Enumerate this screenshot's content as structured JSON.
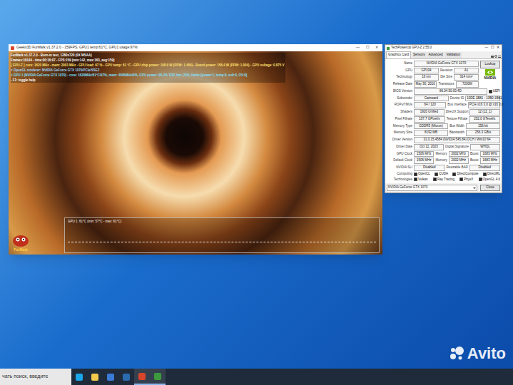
{
  "furmark": {
    "title": "Geeks3D FurMark v1.37.2.0 - 159FPS, GPU1 temp:61°C, GPU1 usage:97%",
    "controls": [
      "—",
      "☐",
      "✕"
    ],
    "overlay": [
      {
        "text": "FurMark v1.37.2.0 - Burn-in test, 1280x720 (0X MSAA)",
        "color": "#ffffff"
      },
      {
        "text": "Frames:16144 - time:00:16:07 - FPS:159 (min:142, max:163, avg:159)",
        "color": "#ffffff"
      },
      {
        "text": "[ GPU-Z ] core: 1620 MHz - mem: 2003 MHz - GPU load: 97 % - GPU temp: 61 °C - GPU chip power: 108.9 W (PPW: 1.460) - Board power: 158.4 W (PPW: 1.004) - GPU voltage: 0.875 V",
        "color": "#ffe070"
      },
      {
        "text": "> OpenGL renderer: NVIDIA GeForce GTX 1070/PCIe/SSE2",
        "color": "#9fd8ff"
      },
      {
        "text": "> GPU 1 (NVIDIA GeForce GTX 1070) - core: 1620MHz/61°C/97%, mem: 4006MHz/6%, GPU power: 96.2% TDP, fan: 23%, limits:[power:1, temp:0, volt:0, OV:0]",
        "color": "#7fe0ff"
      },
      {
        "text": "- F1: toggle help",
        "color": "#ffffff"
      }
    ],
    "graph": {
      "label": "GPU 1: 61°C (min: 57°C - max: 61°C)",
      "level": 0.61
    },
    "logo": "FurMark"
  },
  "gpuz": {
    "title": "TechPowerUp GPU-Z 2.55.0",
    "tabs": [
      {
        "label": "Graphics Card",
        "selected": true
      },
      {
        "label": "Sensors",
        "selected": false
      },
      {
        "label": "Advanced",
        "selected": false
      },
      {
        "label": "Validation",
        "selected": false
      }
    ],
    "logo": "NVIDIA",
    "name": {
      "label": "Name",
      "value": "NVIDIA GeForce GTX 1070",
      "button": "Lookup"
    },
    "rows": [
      {
        "fields": [
          {
            "label": "GPU",
            "value": "GP104"
          },
          {
            "label": "Revision",
            "value": "A1"
          }
        ]
      },
      {
        "fields": [
          {
            "label": "Technology",
            "value": "16 nm"
          },
          {
            "label": "Die Size",
            "value": "314 mm²"
          }
        ]
      },
      {
        "fields": [
          {
            "label": "Release Date",
            "value": "May 30, 2016"
          },
          {
            "label": "Transistors",
            "value": "7200M"
          }
        ]
      },
      {
        "fields": [
          {
            "label": "BIOS Version",
            "value": "86.04.50.00.4D"
          }
        ],
        "checkbox": {
          "label": "UEFI",
          "checked": true
        }
      },
      {
        "fields": [
          {
            "label": "Subvendor",
            "value": "Gainward"
          },
          {
            "label": "Device ID",
            "value": "10DE 1B81 - 10B0 1B81"
          }
        ]
      },
      {
        "fields": [
          {
            "label": "ROPs/TMUs",
            "value": "64 / 120"
          },
          {
            "label": "Bus Interface",
            "value": "PCIe x16 3.0 @ x16 3.0"
          }
        ]
      },
      {
        "fields": [
          {
            "label": "Shaders",
            "value": "1920 Unified"
          },
          {
            "label": "DirectX Support",
            "value": "12 (12_1)"
          }
        ]
      },
      {
        "fields": [
          {
            "label": "Pixel Fillrate",
            "value": "107.7 GPixel/s"
          },
          {
            "label": "Texture Fillrate",
            "value": "202.0 GTexel/s"
          }
        ]
      },
      {
        "fields": [
          {
            "label": "Memory Type",
            "value": "GDDR5 (Micron)"
          },
          {
            "label": "Bus Width",
            "value": "256 bit"
          }
        ]
      },
      {
        "fields": [
          {
            "label": "Memory Size",
            "value": "8192 MB"
          },
          {
            "label": "Bandwidth",
            "value": "256.3 GB/s"
          }
        ]
      },
      {
        "fields": [
          {
            "label": "Driver Version",
            "value": "31.0.15.4584 (NVIDIA 545.84) DCH / Win10 64"
          }
        ]
      },
      {
        "fields": [
          {
            "label": "Driver Date",
            "value": "Oct 11, 2023"
          },
          {
            "label": "Digital Signature",
            "value": "WHQL"
          }
        ]
      },
      {
        "fields": [
          {
            "label": "GPU Clock",
            "value": "1506 MHz"
          },
          {
            "label": "Memory",
            "value": "2002 MHz"
          },
          {
            "label": "Boost",
            "value": "1683 MHz"
          }
        ]
      },
      {
        "fields": [
          {
            "label": "Default Clock",
            "value": "1506 MHz"
          },
          {
            "label": "Memory",
            "value": "2002 MHz"
          },
          {
            "label": "Boost",
            "value": "1683 MHz"
          }
        ]
      },
      {
        "fields": [
          {
            "label": "NVIDIA SLI",
            "value": "Disabled"
          },
          {
            "label": "Resizable BAR",
            "value": "Disabled"
          }
        ]
      }
    ],
    "checkRows": [
      {
        "label": "Computing",
        "checks": [
          {
            "label": "OpenCL",
            "checked": true
          },
          {
            "label": "CUDA",
            "checked": true
          },
          {
            "label": "DirectCompute",
            "checked": true
          },
          {
            "label": "DirectML",
            "checked": true
          }
        ]
      },
      {
        "label": "Technologies",
        "checks": [
          {
            "label": "Vulkan",
            "checked": true
          },
          {
            "label": "Ray Tracing",
            "checked": true
          },
          {
            "label": "PhysX",
            "checked": true
          },
          {
            "label": "OpenGL 4.6",
            "checked": true
          }
        ]
      }
    ],
    "select": "NVIDIA GeForce GTX 1070",
    "close": "Close"
  },
  "taskbar": {
    "search": "чать поиск, введите",
    "apps": [
      {
        "running": false
      },
      {
        "running": false
      },
      {
        "running": false
      },
      {
        "running": false
      },
      {
        "running": true
      },
      {
        "running": true
      }
    ]
  },
  "watermark": "Avito"
}
